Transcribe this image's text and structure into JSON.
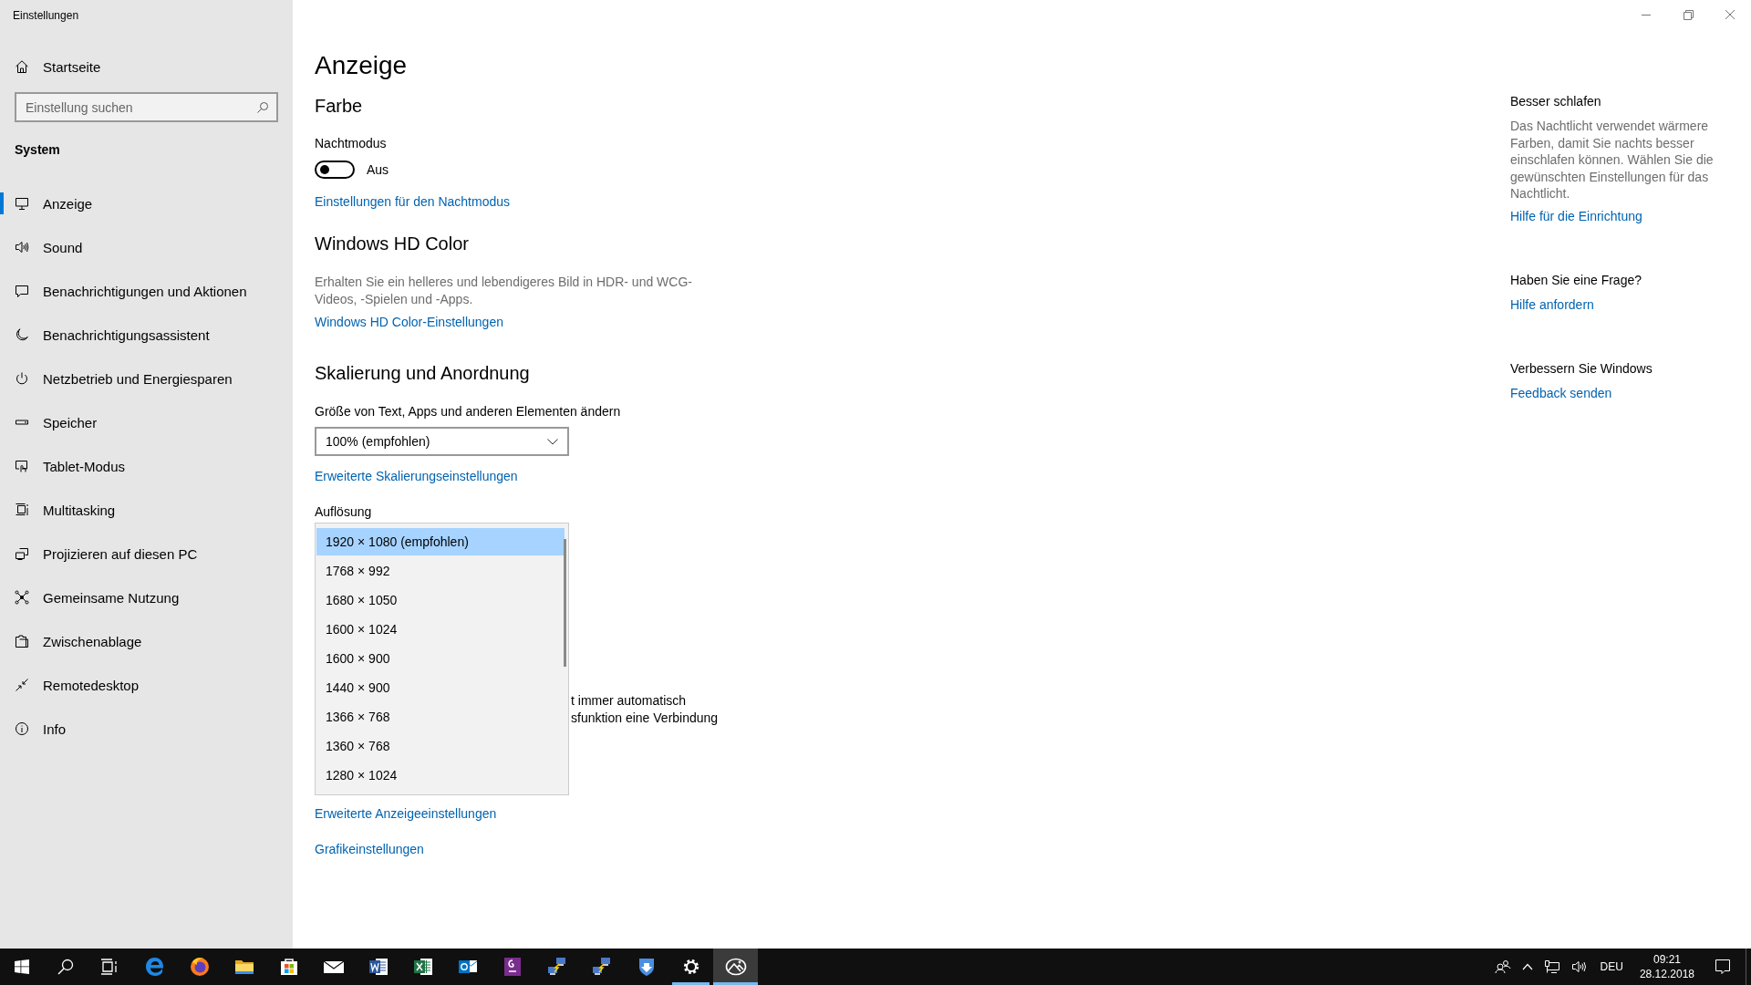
{
  "window": {
    "title": "Einstellungen"
  },
  "sidebar": {
    "home": {
      "label": "Startseite"
    },
    "search": {
      "placeholder": "Einstellung suchen"
    },
    "section": "System",
    "items": [
      {
        "label": "Anzeige",
        "selected": true
      },
      {
        "label": "Sound",
        "selected": false
      },
      {
        "label": "Benachrichtigungen und Aktionen",
        "selected": false
      },
      {
        "label": "Benachrichtigungsassistent",
        "selected": false
      },
      {
        "label": "Netzbetrieb und Energiesparen",
        "selected": false
      },
      {
        "label": "Speicher",
        "selected": false
      },
      {
        "label": "Tablet-Modus",
        "selected": false
      },
      {
        "label": "Multitasking",
        "selected": false
      },
      {
        "label": "Projizieren auf diesen PC",
        "selected": false
      },
      {
        "label": "Gemeinsame Nutzung",
        "selected": false
      },
      {
        "label": "Zwischenablage",
        "selected": false
      },
      {
        "label": "Remotedesktop",
        "selected": false
      },
      {
        "label": "Info",
        "selected": false
      }
    ]
  },
  "main": {
    "title": "Anzeige",
    "color": {
      "heading": "Farbe",
      "night_mode": {
        "label": "Nachtmodus",
        "on": false,
        "state_text": "Aus"
      },
      "link": "Einstellungen für den Nachtmodus"
    },
    "hd_color": {
      "heading": "Windows HD Color",
      "description": "Erhalten Sie ein helleres und lebendigeres Bild in HDR- und WCG-Videos, -Spielen und -Apps.",
      "link": "Windows HD Color-Einstellungen"
    },
    "scaling": {
      "heading": "Skalierung und Anordnung",
      "scale_label": "Größe von Text, Apps und anderen Elementen ändern",
      "scale_value": "100% (empfohlen)",
      "scale_link": "Erweiterte Skalierungseinstellungen",
      "resolution_label": "Auflösung",
      "resolution_options": [
        {
          "label": "1920 × 1080 (empfohlen)",
          "selected": true
        },
        {
          "label": "1768 × 992",
          "selected": false
        },
        {
          "label": "1680 × 1050",
          "selected": false
        },
        {
          "label": "1600 × 1024",
          "selected": false
        },
        {
          "label": "1600 × 900",
          "selected": false
        },
        {
          "label": "1440 × 900",
          "selected": false
        },
        {
          "label": "1366 × 768",
          "selected": false
        },
        {
          "label": "1360 × 768",
          "selected": false
        },
        {
          "label": "1280 × 1024",
          "selected": false
        }
      ],
      "covered_text": [
        "t immer automatisch",
        "sfunktion eine Verbindung"
      ]
    },
    "links": [
      "Erweiterte Anzeigeeinstellungen",
      "Grafikeinstellungen"
    ]
  },
  "aside": [
    {
      "heading": "Besser schlafen",
      "text": "Das Nachtlicht verwendet wärmere Farben, damit Sie nachts besser einschlafen können. Wählen Sie die gewünschten Einstellungen für das Nachtlicht.",
      "link": "Hilfe für die Einrichtung"
    },
    {
      "heading": "Haben Sie eine Frage?",
      "link": "Hilfe anfordern"
    },
    {
      "heading": "Verbessern Sie Windows",
      "link": "Feedback senden"
    }
  ],
  "taskbar": {
    "apps": [
      {
        "running": false,
        "selected": false
      },
      {
        "running": false,
        "selected": false
      },
      {
        "running": false,
        "selected": false
      },
      {
        "running": false,
        "selected": false
      },
      {
        "running": false,
        "selected": false
      },
      {
        "running": false,
        "selected": false
      },
      {
        "running": false,
        "selected": false
      },
      {
        "running": false,
        "selected": false
      },
      {
        "running": false,
        "selected": false
      },
      {
        "running": false,
        "selected": false
      },
      {
        "running": false,
        "selected": false
      },
      {
        "running": false,
        "selected": false
      },
      {
        "running": true,
        "selected": false
      },
      {
        "running": true,
        "selected": true
      }
    ],
    "tray": {
      "language": "DEU",
      "time": "09:21",
      "date": "28.12.2018"
    }
  }
}
